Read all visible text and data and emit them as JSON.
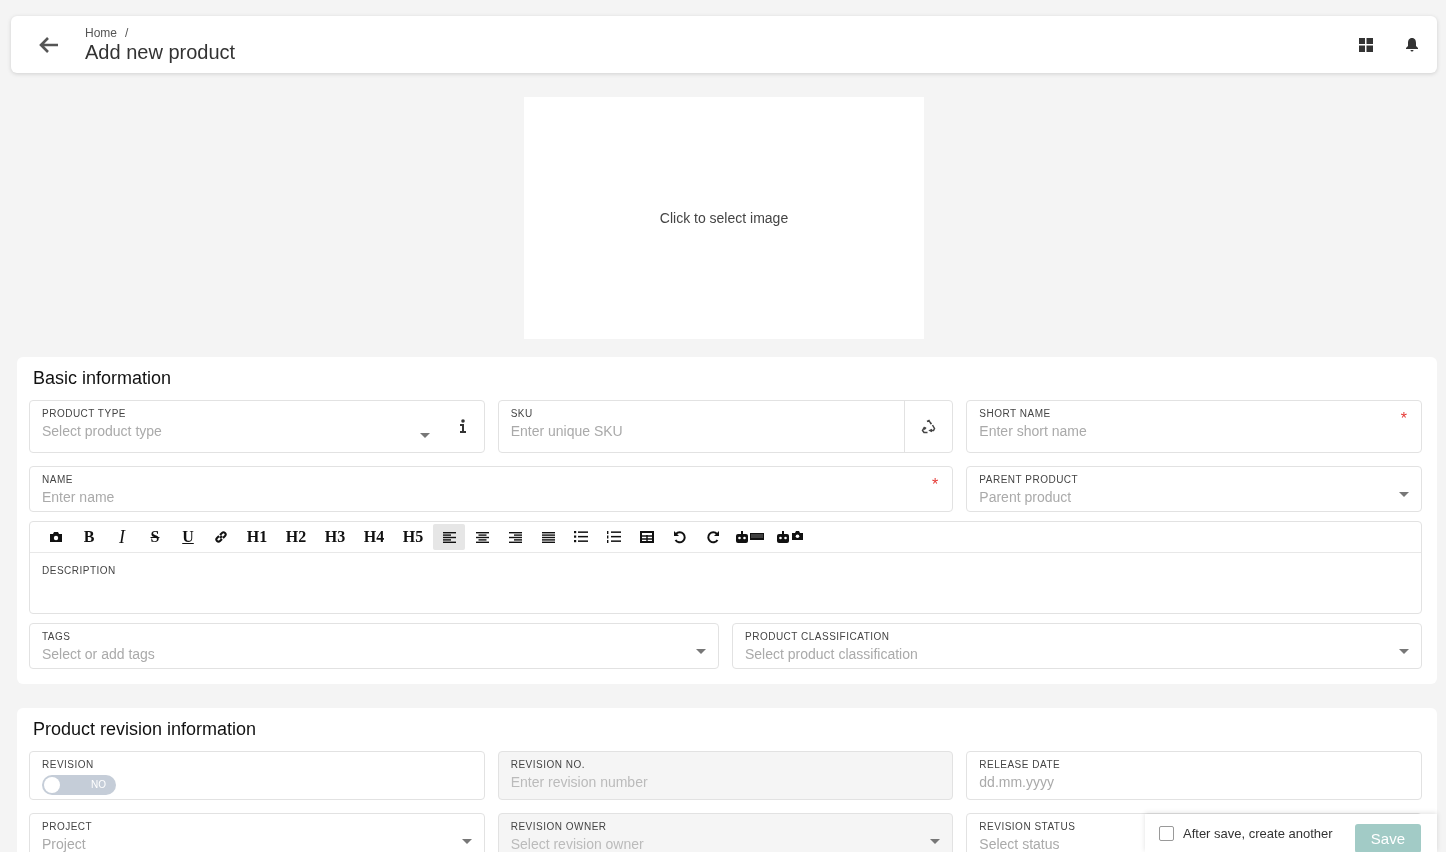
{
  "header": {
    "breadcrumb": "Home",
    "separator": "/",
    "title": "Add new product"
  },
  "image_picker": {
    "prompt": "Click to select image"
  },
  "basic": {
    "title": "Basic information",
    "fields": [
      {
        "kind": "select",
        "label": "PRODUCT TYPE",
        "placeholder": "Select product type",
        "info": true
      },
      {
        "kind": "action",
        "label": "SKU",
        "placeholder": "Enter unique SKU"
      },
      {
        "kind": "input",
        "label": "SHORT NAME",
        "placeholder": "Enter short name",
        "required_mark": "*"
      },
      {
        "kind": "input",
        "label": "NAME",
        "placeholder": "Enter name",
        "required_mark": "*"
      },
      {
        "kind": "select",
        "label": "PARENT PRODUCT",
        "placeholder": "Parent product"
      }
    ],
    "editor": {
      "label": "DESCRIPTION",
      "toolbar": [
        {
          "kind": "icon",
          "selected": false
        },
        {
          "kind": "bold",
          "label": "B",
          "selected": false
        },
        {
          "kind": "italic",
          "label": "I",
          "selected": false
        },
        {
          "kind": "strike",
          "label": "S",
          "selected": false
        },
        {
          "kind": "underline",
          "label": "U",
          "selected": false
        },
        {
          "kind": "icon",
          "selected": false
        },
        {
          "kind": "heading",
          "label": "H1",
          "selected": false
        },
        {
          "kind": "heading",
          "label": "H2",
          "selected": false
        },
        {
          "kind": "heading",
          "label": "H3",
          "selected": false
        },
        {
          "kind": "heading",
          "label": "H4",
          "selected": false
        },
        {
          "kind": "heading",
          "label": "H5",
          "selected": false
        },
        {
          "kind": "icon",
          "selected": true
        },
        {
          "kind": "icon",
          "selected": false
        },
        {
          "kind": "icon",
          "selected": false
        },
        {
          "kind": "icon",
          "selected": false
        },
        {
          "kind": "icon",
          "selected": false
        },
        {
          "kind": "icon",
          "selected": false
        },
        {
          "kind": "icon",
          "selected": false
        },
        {
          "kind": "icon",
          "selected": false
        },
        {
          "kind": "icon",
          "selected": false
        },
        {
          "kind": "icon",
          "selected": false
        },
        {
          "kind": "icon",
          "selected": false
        }
      ]
    },
    "fields_after": [
      {
        "kind": "select",
        "label": "TAGS",
        "placeholder": "Select or add tags"
      },
      {
        "kind": "select",
        "label": "PRODUCT CLASSIFICATION",
        "placeholder": "Select product classification"
      }
    ]
  },
  "revision": {
    "title": "Product revision information",
    "fields": [
      {
        "kind": "toggle",
        "label": "REVISION",
        "on": false,
        "toggle_text": "NO"
      },
      {
        "kind": "input",
        "label": "REVISION NO.",
        "placeholder": "Enter revision number",
        "disabled": true
      },
      {
        "kind": "input",
        "label": "RELEASE DATE",
        "placeholder": "dd.mm.yyyy"
      },
      {
        "kind": "select",
        "label": "PROJECT",
        "placeholder": "Project"
      },
      {
        "kind": "select",
        "label": "REVISION OWNER",
        "placeholder": "Select revision owner",
        "disabled": true
      },
      {
        "kind": "select",
        "label": "REVISION STATUS",
        "placeholder": "Select status"
      }
    ]
  },
  "save_bar": {
    "checkbox_label": "After save, create another",
    "checked": false,
    "button": "Save",
    "button_disabled": true
  }
}
